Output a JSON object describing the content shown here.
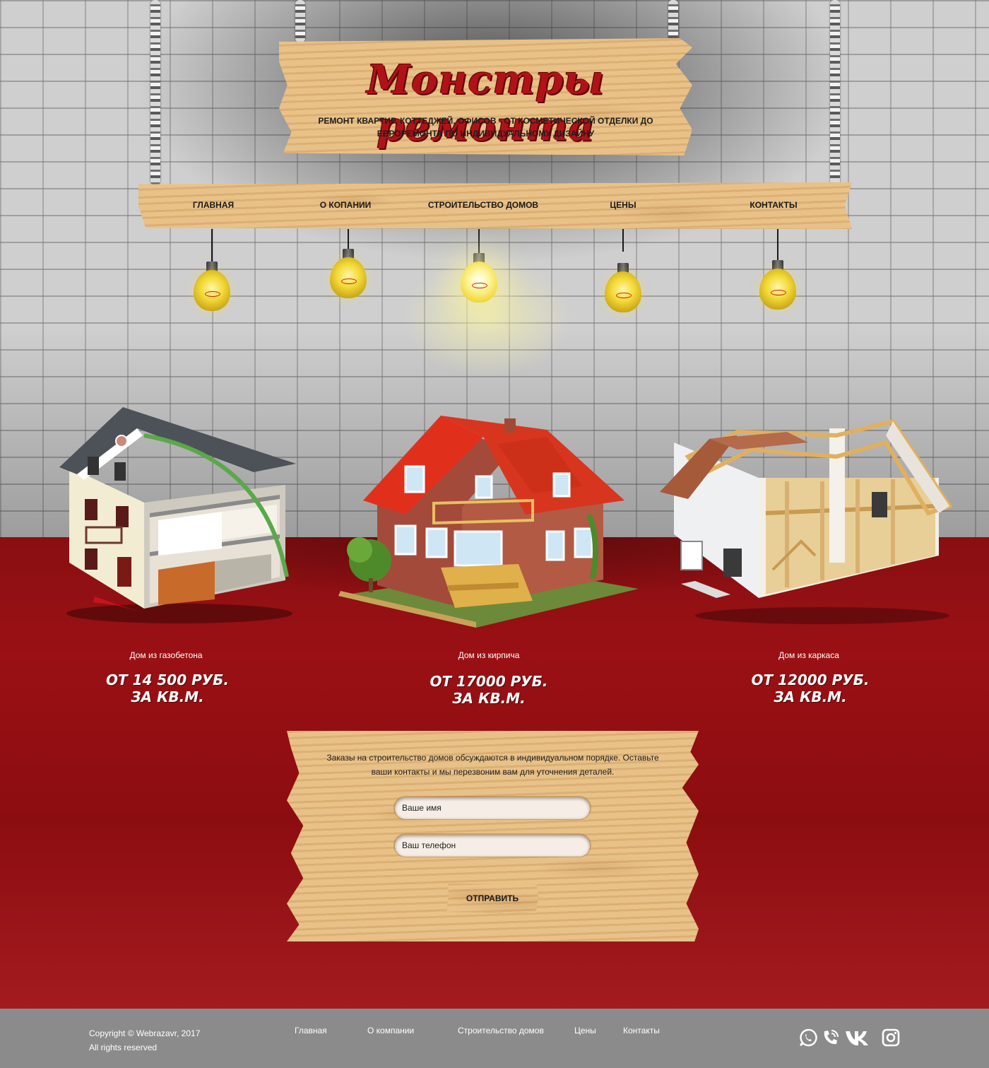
{
  "header": {
    "title": "Монстры ремонта",
    "subtitle": "РЕМОНТ КВАРТИР, КОТТЕДЖЕЙ, ОФИСОВ - ОТ КОСМЕТИЧЕСКОЙ ОТДЕЛКИ ДО ЕВРОРЕМОНТА ПО ИНДИВИДУАЛЬНОМУ ДИЗАЙНУ"
  },
  "nav": {
    "items": [
      {
        "label": "ГЛАВНАЯ"
      },
      {
        "label": "О КОПАНИИ"
      },
      {
        "label": "СТРОИТЕЛЬСТВО ДОМОВ"
      },
      {
        "label": "ЦЕНЫ"
      },
      {
        "label": "КОНТАКТЫ"
      }
    ]
  },
  "houses": [
    {
      "caption": "Дом из газобетона",
      "price_line1": "ОТ 14 500 РУБ.",
      "price_line2": "ЗА КВ.М."
    },
    {
      "caption": "Дом из кирпича",
      "price_line1": "ОТ 17000 РУБ.",
      "price_line2": "ЗА КВ.М."
    },
    {
      "caption": "Дом из каркаса",
      "price_line1": "ОТ 12000 РУБ.",
      "price_line2": "ЗА КВ.М."
    }
  ],
  "form": {
    "text": "Заказы на строительство домов обсуждаются в индивидуальном порядке. Оставьте ваши контакты и мы перезвоним вам для уточнения деталей.",
    "name_placeholder": "Ваше имя",
    "phone_placeholder": "Ваш телефон",
    "submit_label": "ОТПРАВИТЬ"
  },
  "footer": {
    "copyright": "Copyright © Webrazavr, 2017",
    "rights": "All rights reserved",
    "links": [
      "Главная",
      "О компании",
      "Строительство домов",
      "Цены",
      "Контакты"
    ],
    "social_icons": [
      "whatsapp-icon",
      "viber-icon",
      "vk-icon",
      "instagram-icon"
    ]
  },
  "colors": {
    "brand_red": "#b01218",
    "floor_red": "#8c0d10",
    "wood": "#e6bd82",
    "footer_gray": "#8b8b8b"
  }
}
